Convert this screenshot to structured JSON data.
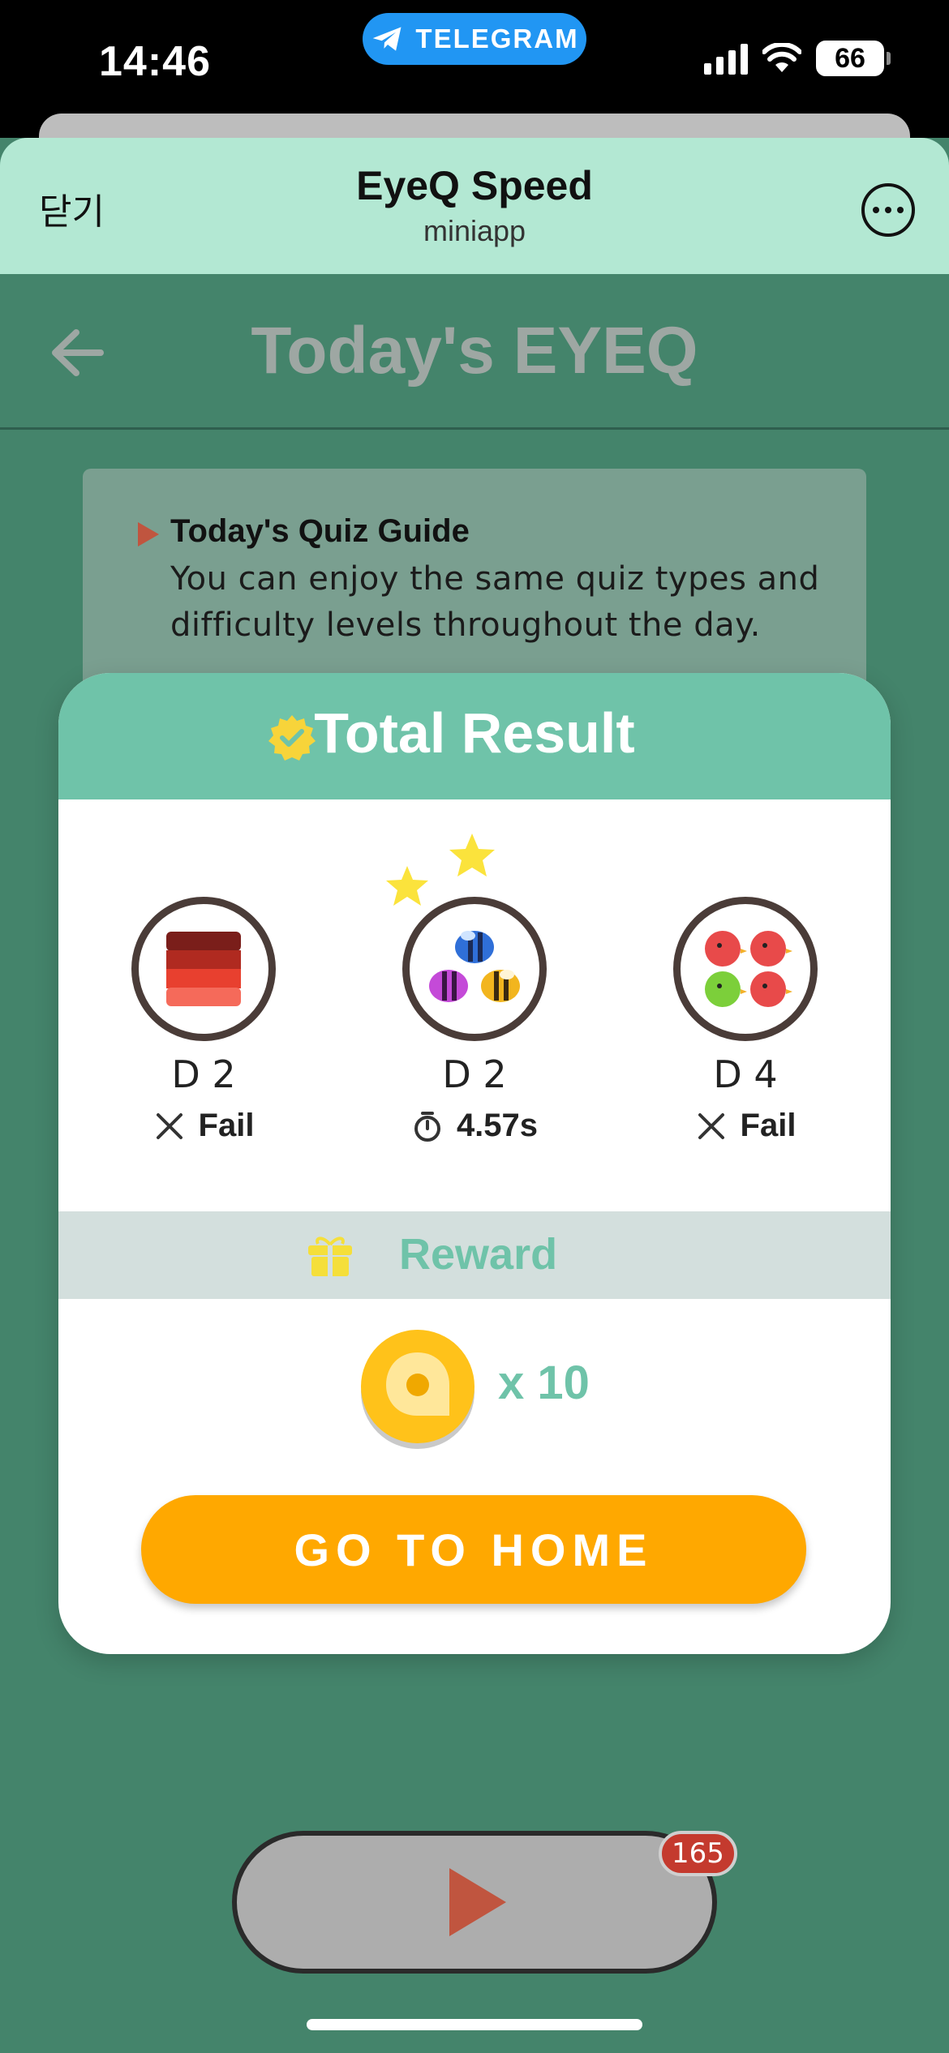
{
  "status_bar": {
    "time": "14:46",
    "app_pill": "TELEGRAM",
    "battery": "66"
  },
  "mini_app": {
    "close_label": "닫기",
    "title": "EyeQ Speed",
    "subtitle": "miniapp"
  },
  "page": {
    "title": "Today's EYEQ"
  },
  "guide": {
    "heading": "Today's Quiz Guide",
    "text": "You can enjoy the same quiz types and difficulty levels throughout the day."
  },
  "result": {
    "title": "Total Result",
    "quizzes": [
      {
        "level": "D 2",
        "result": "Fail",
        "status": "fail",
        "icon": "color-blocks-icon"
      },
      {
        "level": "D 2",
        "result": "4.57s",
        "status": "time",
        "icon": "bees-icon",
        "stars": 2
      },
      {
        "level": "D 4",
        "result": "Fail",
        "status": "fail",
        "icon": "birds-icon"
      }
    ],
    "reward_label": "Reward",
    "reward_amount": "x 10",
    "home_button": "GO TO HOME"
  },
  "play": {
    "badge_count": "165"
  },
  "colors": {
    "background": "#44846b",
    "header": "#b3e8d3",
    "accent": "#6fc3a9",
    "button": "#ffa800",
    "badge": "#c43a2e"
  }
}
